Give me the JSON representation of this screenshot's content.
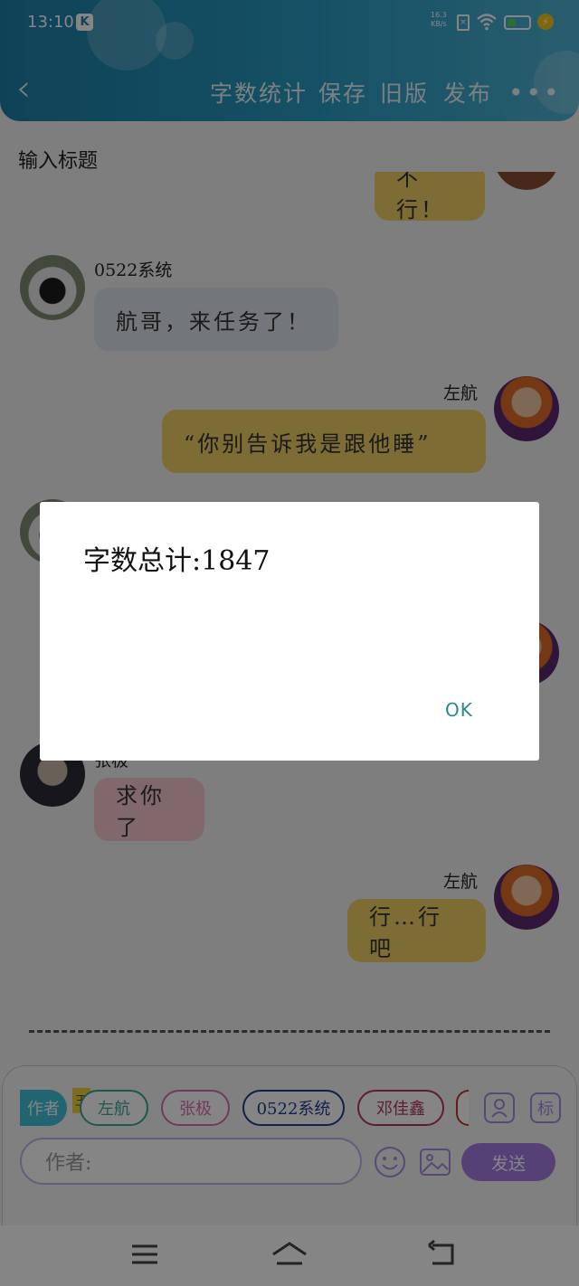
{
  "status_bar": {
    "time": "13:10",
    "app_badge": "K",
    "net_speed_value": "16.3",
    "net_speed_unit": "KB/s"
  },
  "header": {
    "actions": [
      "字数统计",
      "保存",
      "旧版",
      "发布"
    ],
    "more": "•••"
  },
  "title_field": {
    "placeholder": "输入标题"
  },
  "messages": [
    {
      "id": "m0",
      "sender": "",
      "text": "不行！",
      "side": "right",
      "color": "yellow"
    },
    {
      "id": "m1",
      "sender": "0522系统",
      "text": "航哥，来任务了！",
      "side": "left",
      "color": "grey"
    },
    {
      "id": "m2",
      "sender": "左航",
      "text": "“你别告诉我是跟他睡”",
      "side": "right",
      "color": "yellow"
    },
    {
      "id": "m3",
      "sender": "张极",
      "text": "求你了",
      "side": "left",
      "color": "pink"
    },
    {
      "id": "m4",
      "sender": "左航",
      "text": "行…行吧",
      "side": "right",
      "color": "yellow"
    }
  ],
  "dialog": {
    "message": "字数总计:1847",
    "ok_label": "OK"
  },
  "composer": {
    "author_tab": "作者",
    "crown_mark": "王",
    "chips": [
      {
        "label": "左航",
        "color": "#3aa89a"
      },
      {
        "label": "张极",
        "color": "#d66fb5"
      },
      {
        "label": "0522系统",
        "color": "#1f3f8a"
      },
      {
        "label": "邓佳鑫",
        "color": "#b4365c"
      }
    ],
    "right_icon_text": "标",
    "input_placeholder": "作者:",
    "send_label": "发送"
  },
  "colors": {
    "accent": "#2a9cc4",
    "send": "#a47ee0",
    "bubble_self": "#f0d064"
  }
}
